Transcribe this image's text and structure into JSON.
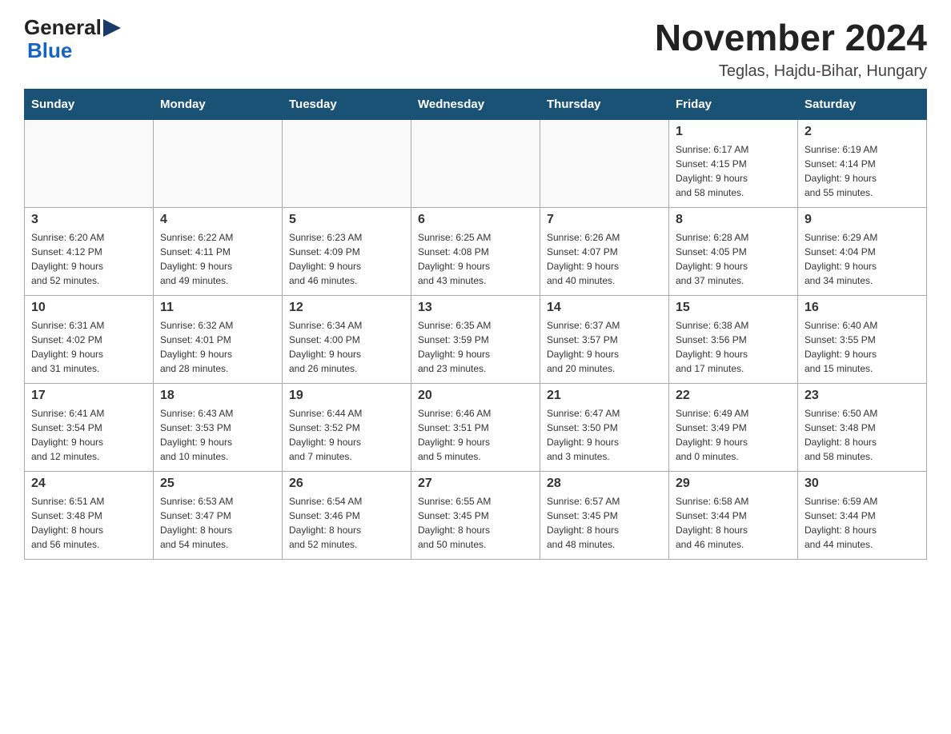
{
  "logo": {
    "general": "General",
    "blue": "Blue"
  },
  "header": {
    "month_year": "November 2024",
    "location": "Teglas, Hajdu-Bihar, Hungary"
  },
  "weekdays": [
    "Sunday",
    "Monday",
    "Tuesday",
    "Wednesday",
    "Thursday",
    "Friday",
    "Saturday"
  ],
  "weeks": [
    [
      {
        "day": "",
        "info": ""
      },
      {
        "day": "",
        "info": ""
      },
      {
        "day": "",
        "info": ""
      },
      {
        "day": "",
        "info": ""
      },
      {
        "day": "",
        "info": ""
      },
      {
        "day": "1",
        "info": "Sunrise: 6:17 AM\nSunset: 4:15 PM\nDaylight: 9 hours\nand 58 minutes."
      },
      {
        "day": "2",
        "info": "Sunrise: 6:19 AM\nSunset: 4:14 PM\nDaylight: 9 hours\nand 55 minutes."
      }
    ],
    [
      {
        "day": "3",
        "info": "Sunrise: 6:20 AM\nSunset: 4:12 PM\nDaylight: 9 hours\nand 52 minutes."
      },
      {
        "day": "4",
        "info": "Sunrise: 6:22 AM\nSunset: 4:11 PM\nDaylight: 9 hours\nand 49 minutes."
      },
      {
        "day": "5",
        "info": "Sunrise: 6:23 AM\nSunset: 4:09 PM\nDaylight: 9 hours\nand 46 minutes."
      },
      {
        "day": "6",
        "info": "Sunrise: 6:25 AM\nSunset: 4:08 PM\nDaylight: 9 hours\nand 43 minutes."
      },
      {
        "day": "7",
        "info": "Sunrise: 6:26 AM\nSunset: 4:07 PM\nDaylight: 9 hours\nand 40 minutes."
      },
      {
        "day": "8",
        "info": "Sunrise: 6:28 AM\nSunset: 4:05 PM\nDaylight: 9 hours\nand 37 minutes."
      },
      {
        "day": "9",
        "info": "Sunrise: 6:29 AM\nSunset: 4:04 PM\nDaylight: 9 hours\nand 34 minutes."
      }
    ],
    [
      {
        "day": "10",
        "info": "Sunrise: 6:31 AM\nSunset: 4:02 PM\nDaylight: 9 hours\nand 31 minutes."
      },
      {
        "day": "11",
        "info": "Sunrise: 6:32 AM\nSunset: 4:01 PM\nDaylight: 9 hours\nand 28 minutes."
      },
      {
        "day": "12",
        "info": "Sunrise: 6:34 AM\nSunset: 4:00 PM\nDaylight: 9 hours\nand 26 minutes."
      },
      {
        "day": "13",
        "info": "Sunrise: 6:35 AM\nSunset: 3:59 PM\nDaylight: 9 hours\nand 23 minutes."
      },
      {
        "day": "14",
        "info": "Sunrise: 6:37 AM\nSunset: 3:57 PM\nDaylight: 9 hours\nand 20 minutes."
      },
      {
        "day": "15",
        "info": "Sunrise: 6:38 AM\nSunset: 3:56 PM\nDaylight: 9 hours\nand 17 minutes."
      },
      {
        "day": "16",
        "info": "Sunrise: 6:40 AM\nSunset: 3:55 PM\nDaylight: 9 hours\nand 15 minutes."
      }
    ],
    [
      {
        "day": "17",
        "info": "Sunrise: 6:41 AM\nSunset: 3:54 PM\nDaylight: 9 hours\nand 12 minutes."
      },
      {
        "day": "18",
        "info": "Sunrise: 6:43 AM\nSunset: 3:53 PM\nDaylight: 9 hours\nand 10 minutes."
      },
      {
        "day": "19",
        "info": "Sunrise: 6:44 AM\nSunset: 3:52 PM\nDaylight: 9 hours\nand 7 minutes."
      },
      {
        "day": "20",
        "info": "Sunrise: 6:46 AM\nSunset: 3:51 PM\nDaylight: 9 hours\nand 5 minutes."
      },
      {
        "day": "21",
        "info": "Sunrise: 6:47 AM\nSunset: 3:50 PM\nDaylight: 9 hours\nand 3 minutes."
      },
      {
        "day": "22",
        "info": "Sunrise: 6:49 AM\nSunset: 3:49 PM\nDaylight: 9 hours\nand 0 minutes."
      },
      {
        "day": "23",
        "info": "Sunrise: 6:50 AM\nSunset: 3:48 PM\nDaylight: 8 hours\nand 58 minutes."
      }
    ],
    [
      {
        "day": "24",
        "info": "Sunrise: 6:51 AM\nSunset: 3:48 PM\nDaylight: 8 hours\nand 56 minutes."
      },
      {
        "day": "25",
        "info": "Sunrise: 6:53 AM\nSunset: 3:47 PM\nDaylight: 8 hours\nand 54 minutes."
      },
      {
        "day": "26",
        "info": "Sunrise: 6:54 AM\nSunset: 3:46 PM\nDaylight: 8 hours\nand 52 minutes."
      },
      {
        "day": "27",
        "info": "Sunrise: 6:55 AM\nSunset: 3:45 PM\nDaylight: 8 hours\nand 50 minutes."
      },
      {
        "day": "28",
        "info": "Sunrise: 6:57 AM\nSunset: 3:45 PM\nDaylight: 8 hours\nand 48 minutes."
      },
      {
        "day": "29",
        "info": "Sunrise: 6:58 AM\nSunset: 3:44 PM\nDaylight: 8 hours\nand 46 minutes."
      },
      {
        "day": "30",
        "info": "Sunrise: 6:59 AM\nSunset: 3:44 PM\nDaylight: 8 hours\nand 44 minutes."
      }
    ]
  ]
}
